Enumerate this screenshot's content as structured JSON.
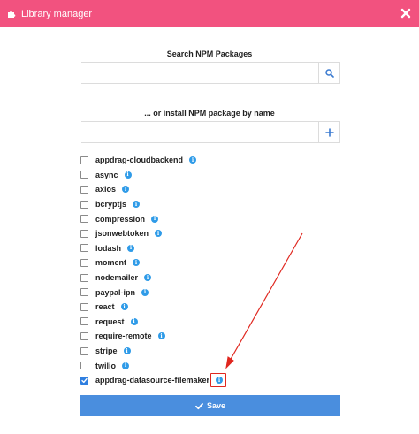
{
  "header": {
    "title": "Library manager",
    "bg_color": "#f2527f"
  },
  "search": {
    "label": "Search NPM Packages",
    "value": "",
    "placeholder": ""
  },
  "install": {
    "label": "... or install NPM package by name",
    "value": "",
    "placeholder": ""
  },
  "packages": [
    {
      "name": "appdrag-cloudbackend",
      "checked": false
    },
    {
      "name": "async",
      "checked": false
    },
    {
      "name": "axios",
      "checked": false
    },
    {
      "name": "bcryptjs",
      "checked": false
    },
    {
      "name": "compression",
      "checked": false
    },
    {
      "name": "jsonwebtoken",
      "checked": false
    },
    {
      "name": "lodash",
      "checked": false
    },
    {
      "name": "moment",
      "checked": false
    },
    {
      "name": "nodemailer",
      "checked": false
    },
    {
      "name": "paypal-ipn",
      "checked": false
    },
    {
      "name": "react",
      "checked": false
    },
    {
      "name": "request",
      "checked": false
    },
    {
      "name": "require-remote",
      "checked": false
    },
    {
      "name": "stripe",
      "checked": false
    },
    {
      "name": "twilio",
      "checked": false
    },
    {
      "name": "appdrag-datasource-filemaker",
      "checked": true
    }
  ],
  "save": {
    "label": "Save",
    "bg_color": "#4a8ede"
  },
  "annotation": {
    "color": "#e0271f"
  }
}
